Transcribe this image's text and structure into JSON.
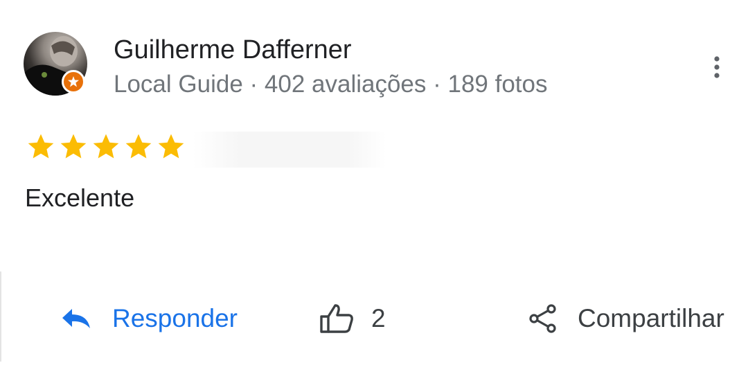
{
  "reviewer": {
    "name": "Guilherme Dafferner",
    "meta": "Local Guide · 402 avaliações · 189 fotos"
  },
  "rating": {
    "stars": 5,
    "max": 5,
    "star_color": "#fbbc04"
  },
  "review": {
    "text": "Excelente"
  },
  "actions": {
    "reply_label": "Responder",
    "like_count": "2",
    "share_label": "Compartilhar"
  },
  "colors": {
    "link": "#1a73e8",
    "badge": "#e8710a",
    "meta_text": "#70757a"
  },
  "icons": {
    "reply": "reply-arrow-icon",
    "like": "thumbs-up-icon",
    "share": "share-icon",
    "more": "more-vertical-icon",
    "badge": "local-guide-badge-icon"
  }
}
